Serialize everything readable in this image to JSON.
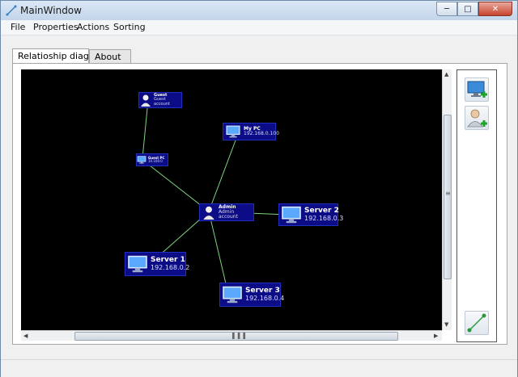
{
  "window": {
    "title": "MainWindow"
  },
  "menu": {
    "file": "File",
    "properties": "Properties",
    "actions": "Actions",
    "sorting": "Sorting"
  },
  "tabs": {
    "relationship": "Relatioship diagram",
    "about": "About"
  },
  "nodes": {
    "guest": {
      "name": "Guest",
      "address": "Guest account"
    },
    "guest_pc": {
      "name": "Guest PC",
      "address": "10.100.0"
    },
    "my_pc": {
      "name": "My PC",
      "address": "192.168.0.100"
    },
    "admin": {
      "name": "Admin",
      "address": "Admin account"
    },
    "server2": {
      "name": "Server 2",
      "address": "192.168.0.3"
    },
    "server1": {
      "name": "Server 1",
      "address": "192.168.0.2"
    },
    "server3": {
      "name": "Server 3",
      "address": "192.168.0.4"
    }
  },
  "colors": {
    "canvas": "#000000",
    "node_fill": "#0c0c86",
    "edge": "#7fd27f",
    "accent": "#1f2fbf"
  },
  "icons": [
    "monitor-icon",
    "user-icon",
    "add-computer-icon",
    "add-user-icon",
    "connect-line-icon"
  ]
}
